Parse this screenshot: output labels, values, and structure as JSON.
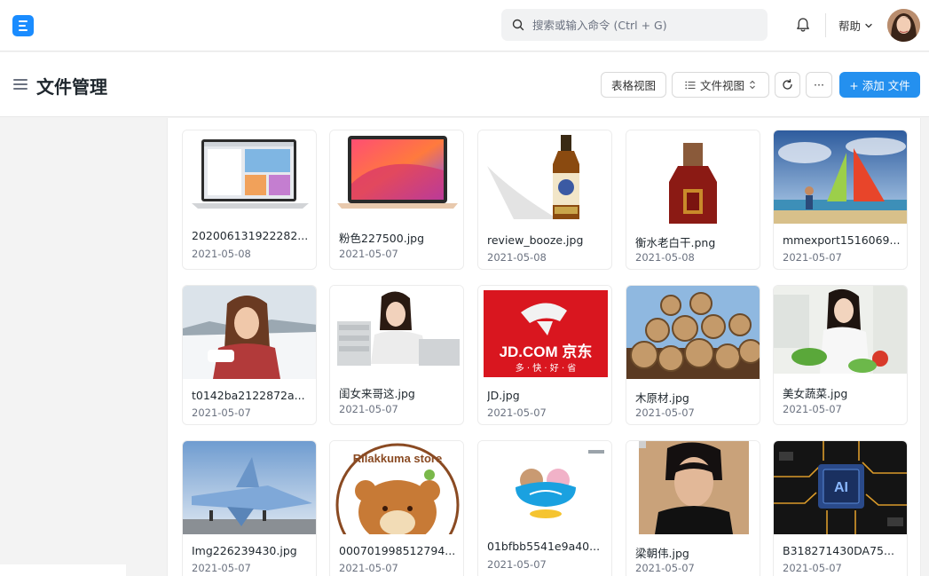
{
  "navbar": {
    "logo_icon": "app-logo",
    "search_placeholder": "搜索或输入命令 (Ctrl + G)",
    "help_label": "帮助",
    "accent_color": "#2490ef"
  },
  "page": {
    "title": "文件管理",
    "buttons": {
      "table_view": "表格视图",
      "file_view": "文件视图",
      "more": "···",
      "add": "+ 添加 文件"
    }
  },
  "files": [
    {
      "name": "202006131922282...",
      "date": "2021-05-08"
    },
    {
      "name": "粉色227500.jpg",
      "date": "2021-05-07"
    },
    {
      "name": "review_booze.jpg",
      "date": "2021-05-08"
    },
    {
      "name": "衡水老白干.png",
      "date": "2021-05-08"
    },
    {
      "name": "mmexport1516069...",
      "date": "2021-05-07"
    },
    {
      "name": "t0142ba2122872a...",
      "date": "2021-05-07"
    },
    {
      "name": "闺女来哥这.jpg",
      "date": "2021-05-07"
    },
    {
      "name": "JD.jpg",
      "date": "2021-05-07"
    },
    {
      "name": "木原材.jpg",
      "date": "2021-05-07"
    },
    {
      "name": "美女蔬菜.jpg",
      "date": "2021-05-07"
    },
    {
      "name": "Img226239430.jpg",
      "date": "2021-05-07"
    },
    {
      "name": "000701998512794...",
      "date": "2021-05-07"
    },
    {
      "name": "01bfbb5541e9a40...",
      "date": "2021-05-07"
    },
    {
      "name": "梁朝伟.jpg",
      "date": "2021-05-07"
    },
    {
      "name": "B318271430DA75...",
      "date": "2021-05-07"
    }
  ],
  "thumb_text": {
    "jd_brand": "JD.COM 京东",
    "jd_slogan": "多 · 快 · 好 · 省",
    "rilakkuma": "Rilakkuma store",
    "ai_chip": "AI"
  }
}
